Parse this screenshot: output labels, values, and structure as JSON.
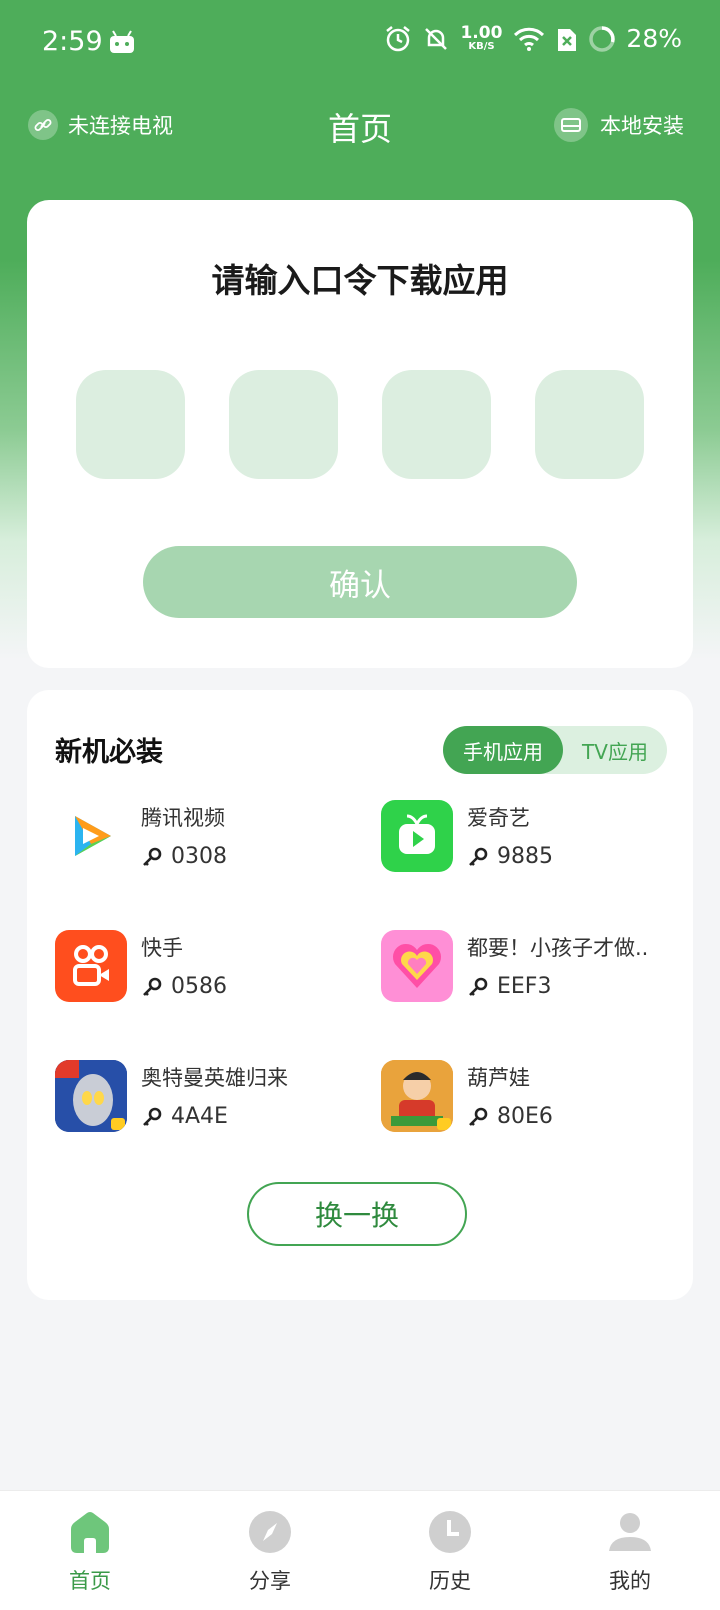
{
  "status_bar": {
    "time": "2:59",
    "net_speed_value": "1.00",
    "net_speed_unit": "KB/S",
    "battery": "28%"
  },
  "header": {
    "tv_status": "未连接电视",
    "title": "首页",
    "local_install": "本地安装"
  },
  "code_card": {
    "title": "请输入口令下载应用",
    "boxes": [
      "",
      "",
      "",
      ""
    ],
    "confirm_label": "确认"
  },
  "apps_section": {
    "title": "新机必装",
    "tabs": [
      "手机应用",
      "TV应用"
    ],
    "active_tab": "手机应用",
    "items": [
      {
        "name": "腾讯视频",
        "code": "0308",
        "icon": "tencent-video-icon"
      },
      {
        "name": "爱奇艺",
        "code": "9885",
        "icon": "iqiyi-icon"
      },
      {
        "name": "快手",
        "code": "0586",
        "icon": "kuaishou-icon"
      },
      {
        "name": "都要！小孩子才做..",
        "code": "EEF3",
        "icon": "heart-game-icon"
      },
      {
        "name": "奥特曼英雄归来",
        "code": "4A4E",
        "icon": "ultraman-icon"
      },
      {
        "name": "葫芦娃",
        "code": "80E6",
        "icon": "calabash-brothers-icon"
      }
    ],
    "swap_label": "换一换"
  },
  "tabbar": {
    "items": [
      {
        "label": "首页",
        "icon": "home-icon"
      },
      {
        "label": "分享",
        "icon": "compass-icon"
      },
      {
        "label": "历史",
        "icon": "clock-icon"
      },
      {
        "label": "我的",
        "icon": "person-icon"
      }
    ],
    "active_index": 0
  },
  "colors": {
    "primary": "#43a553",
    "header_green": "#4ead5a",
    "code_box": "#dceee0",
    "confirm_disabled": "#a7d6b0"
  }
}
